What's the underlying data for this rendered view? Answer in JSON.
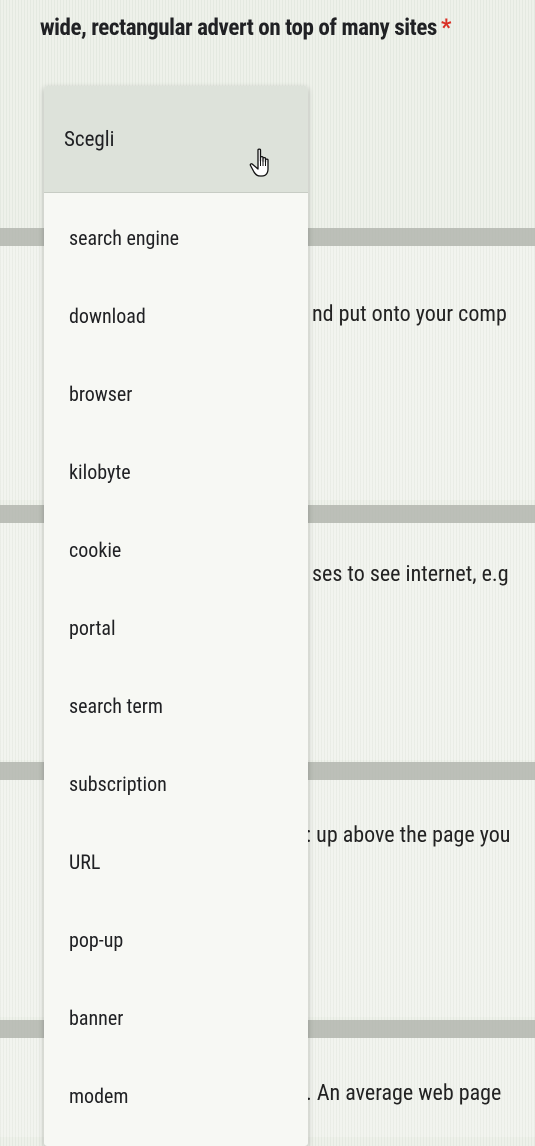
{
  "question": {
    "title": "wide, rectangular advert on top of many sites",
    "required_mark": "*"
  },
  "background_fragments": [
    "nd put onto your comp",
    "ses to see internet, e.g",
    ": up above the page you",
    ". An average web page"
  ],
  "dropdown": {
    "placeholder": "Scegli",
    "options": [
      "search engine",
      "download",
      "browser",
      "kilobyte",
      "cookie",
      "portal",
      "search term",
      "subscription",
      "URL",
      "pop-up",
      "banner",
      "modem"
    ]
  },
  "cursor_icon": "hand-pointer-icon",
  "colors": {
    "required": "#d93025",
    "highlight": "#dde2da",
    "separator": "#a9ada6"
  }
}
